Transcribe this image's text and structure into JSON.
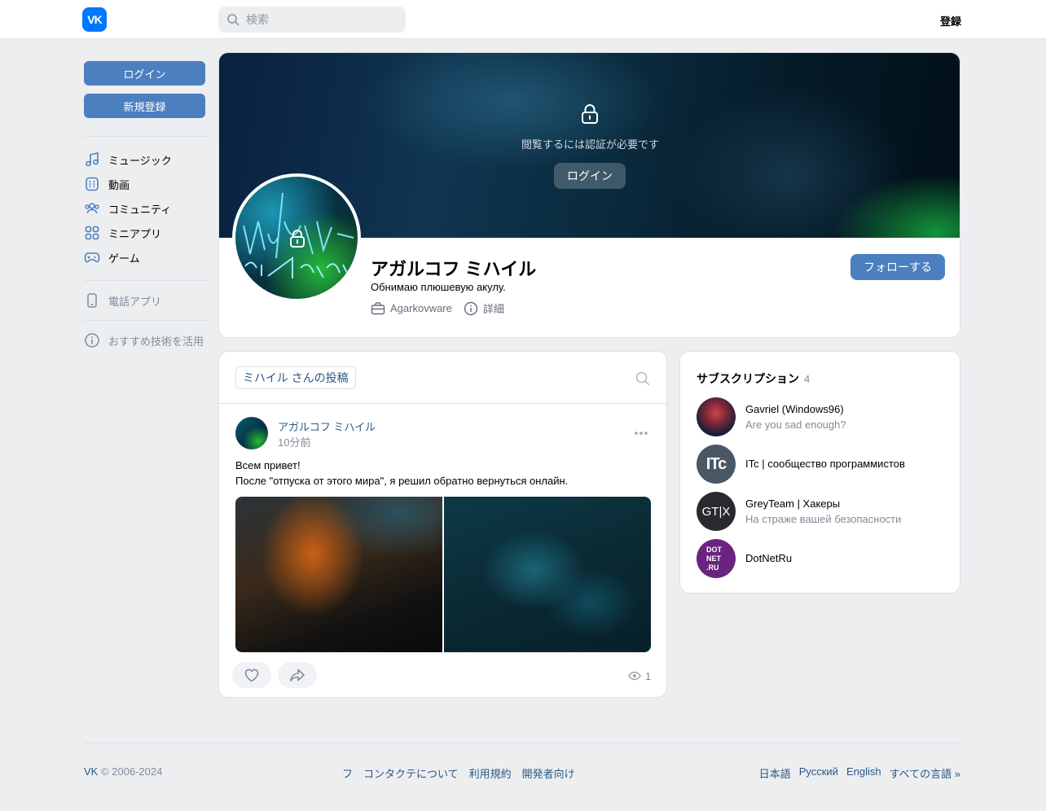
{
  "header": {
    "logo_text": "VK",
    "search_placeholder": "検索",
    "register_label": "登録"
  },
  "sidebar": {
    "login_label": "ログイン",
    "signup_label": "新規登録",
    "items": [
      {
        "label": "ミュージック",
        "icon": "music-icon"
      },
      {
        "label": "動画",
        "icon": "video-icon"
      },
      {
        "label": "コミュニティ",
        "icon": "community-icon"
      },
      {
        "label": "ミニアプリ",
        "icon": "mini-apps-icon"
      },
      {
        "label": "ゲーム",
        "icon": "gamepad-icon"
      }
    ],
    "phone_app_label": "電話アプリ",
    "tech_label": "おすすめ技術を活用"
  },
  "profile": {
    "locked_text": "閲覧するには認証が必要です",
    "locked_login_label": "ログイン",
    "name": "アガルコフ ミハイル",
    "status": "Обнимаю плюшевую акулу.",
    "work": "Agarkovware",
    "details_label": "詳細",
    "follow_label": "フォローする"
  },
  "posts": {
    "tab_label": "ミハイル さんの投稿",
    "post": {
      "author": "アガルコフ ミハイル",
      "time": "10分前",
      "text_line1": "Всем привет!",
      "text_line2": "После \"отпуска от этого мира\", я решил обратно вернуться онлайн.",
      "views": "1"
    }
  },
  "subscriptions": {
    "title": "サブスクリプション",
    "count": "4",
    "items": [
      {
        "name": "Gavriel (Windows96)",
        "desc": "Are you sad enough?"
      },
      {
        "name": "ITc | сообщество программистов",
        "desc": ""
      },
      {
        "name": "GreyTeam | Хакеры",
        "desc": "На страже вашей безопасности"
      },
      {
        "name": "DotNetRu",
        "desc": ""
      }
    ],
    "avatar_texts": [
      "ITc",
      "GT|X",
      "DOT",
      "NET",
      ".RU"
    ]
  },
  "footer": {
    "brand": "VK",
    "copyright": "© 2006-2024",
    "links": [
      "フ",
      "コンタクテについて",
      "利用規約",
      "開発者向け"
    ],
    "languages": [
      "日本語",
      "Русский",
      "English",
      "すべての言語 »"
    ]
  },
  "colors": {
    "accent": "#4b7fc0",
    "link": "#2a5885",
    "muted": "#818c99",
    "background": "#edeef0"
  }
}
